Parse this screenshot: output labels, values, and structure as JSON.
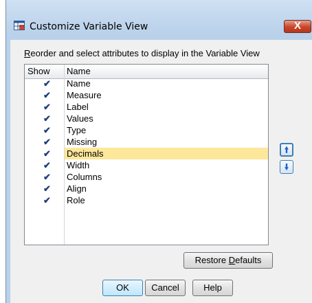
{
  "window": {
    "title": "Customize Variable View",
    "close_label": "X"
  },
  "instruction": {
    "mnemonic": "R",
    "rest": "eorder and select attributes to display in the Variable View"
  },
  "grid": {
    "headers": {
      "show": "Show",
      "name": "Name"
    },
    "rows": [
      {
        "name": "Name",
        "checked": true
      },
      {
        "name": "Measure",
        "checked": true
      },
      {
        "name": "Label",
        "checked": true
      },
      {
        "name": "Values",
        "checked": true
      },
      {
        "name": "Type",
        "checked": true
      },
      {
        "name": "Missing",
        "checked": true
      },
      {
        "name": "Decimals",
        "checked": true,
        "selected": true
      },
      {
        "name": "Width",
        "checked": true
      },
      {
        "name": "Columns",
        "checked": true
      },
      {
        "name": "Align",
        "checked": true
      },
      {
        "name": "Role",
        "checked": true
      }
    ],
    "check_glyph": "✔"
  },
  "buttons": {
    "move_up_icon": "up-arrow-icon",
    "move_down_icon": "down-arrow-icon",
    "restore_prefix": "Restore ",
    "restore_mnemonic": "D",
    "restore_suffix": "efaults",
    "ok": "OK",
    "cancel": "Cancel",
    "help": "Help"
  },
  "colors": {
    "selected_row": "#fde79a",
    "check": "#1f3f7a",
    "close": "#c8452a"
  }
}
